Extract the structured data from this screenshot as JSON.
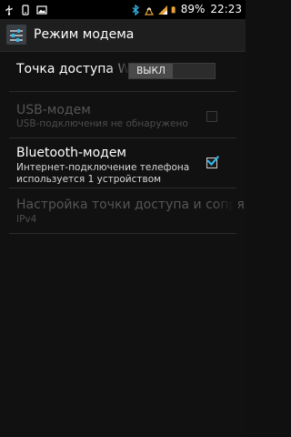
{
  "status_bar": {
    "battery_percent": "89%",
    "time": "22:23",
    "left_icons": [
      "usb-icon",
      "notification-icon",
      "image-icon"
    ],
    "right_icons": [
      "bluetooth-icon",
      "hotspot-icon",
      "signal-icon",
      "battery-icon"
    ]
  },
  "action_bar": {
    "title": "Режим модема",
    "icon": "settings-sliders-icon"
  },
  "settings": {
    "hotspot": {
      "title": "Точка доступа W",
      "toggle_label": "ВЫКЛ",
      "toggle_state": "off"
    },
    "usb_modem": {
      "title": "USB-модем",
      "subtitle": "USB-подключения не обнаружено",
      "enabled": false,
      "checked": false
    },
    "bluetooth_modem": {
      "title": "Bluetooth-модем",
      "subtitle_line1": "Интернет-подключение телефона",
      "subtitle_line2": "используется 1 устройством",
      "enabled": true,
      "checked": true
    },
    "hotspot_settings": {
      "title": "Настройка точки доступа и сопряж",
      "subtitle": "IPv4",
      "enabled": false
    }
  },
  "colors": {
    "background": "#111111",
    "accent": "#33b5e5"
  }
}
